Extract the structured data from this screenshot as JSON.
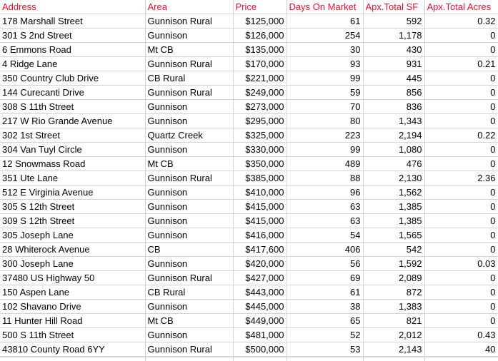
{
  "columns": [
    "Address",
    "Area",
    "Price",
    "Days On Market",
    "Apx.Total SF",
    "Apx.Total Acres"
  ],
  "header_color": "#e8112d",
  "rows": [
    [
      "178 Marshall Street",
      "Gunnison Rural",
      "$125,000",
      "61",
      "592",
      "0.32"
    ],
    [
      "301 S 2nd Street",
      "Gunnison",
      "$126,000",
      "254",
      "1,178",
      "0"
    ],
    [
      "6 Emmons Road",
      "Mt CB",
      "$135,000",
      "30",
      "430",
      "0"
    ],
    [
      "4 Ridge Lane",
      "Gunnison Rural",
      "$170,000",
      "93",
      "931",
      "0.21"
    ],
    [
      "350 Country Club Drive",
      "CB Rural",
      "$221,000",
      "99",
      "445",
      "0"
    ],
    [
      "144 Curecanti Drive",
      "Gunnison Rural",
      "$249,000",
      "59",
      "856",
      "0"
    ],
    [
      "308 S 11th Street",
      "Gunnison",
      "$273,000",
      "70",
      "836",
      "0"
    ],
    [
      "217 W Rio Grande Avenue",
      "Gunnison",
      "$295,000",
      "80",
      "1,343",
      "0"
    ],
    [
      "302 1st Street",
      "Quartz Creek",
      "$325,000",
      "223",
      "2,194",
      "0.22"
    ],
    [
      "304 Van Tuyl Circle",
      "Gunnison",
      "$330,000",
      "99",
      "1,080",
      "0"
    ],
    [
      "12 Snowmass Road",
      "Mt CB",
      "$350,000",
      "489",
      "476",
      "0"
    ],
    [
      "351 Ute Lane",
      "Gunnison Rural",
      "$385,000",
      "88",
      "2,130",
      "2.36"
    ],
    [
      "512 E Virginia Avenue",
      "Gunnison",
      "$410,000",
      "96",
      "1,562",
      "0"
    ],
    [
      "305 S 12th Street",
      "Gunnison",
      "$415,000",
      "63",
      "1,385",
      "0"
    ],
    [
      "309 S 12th Street",
      "Gunnison",
      "$415,000",
      "63",
      "1,385",
      "0"
    ],
    [
      "305 Joseph Lane",
      "Gunnison",
      "$416,000",
      "54",
      "1,565",
      "0"
    ],
    [
      "28 Whiterock Avenue",
      "CB",
      "$417,600",
      "406",
      "542",
      "0"
    ],
    [
      "300 Joseph Lane",
      "Gunnison",
      "$420,000",
      "56",
      "1,592",
      "0.03"
    ],
    [
      "37480 US Highway 50",
      "Gunnison Rural",
      "$427,000",
      "69",
      "2,089",
      "0"
    ],
    [
      "150 Aspen Lane",
      "CB Rural",
      "$443,000",
      "61",
      "872",
      "0"
    ],
    [
      "102 Shavano Drive",
      "Gunnison",
      "$445,000",
      "38",
      "1,383",
      "0"
    ],
    [
      "11 Hunter Hill Road",
      "Mt CB",
      "$449,000",
      "65",
      "821",
      "0"
    ],
    [
      "500 S 11th Street",
      "Gunnison",
      "$481,000",
      "52",
      "2,012",
      "0.43"
    ],
    [
      "43810 County Road 6YY",
      "Gunnison Rural",
      "$500,000",
      "53",
      "2,143",
      "40"
    ]
  ]
}
